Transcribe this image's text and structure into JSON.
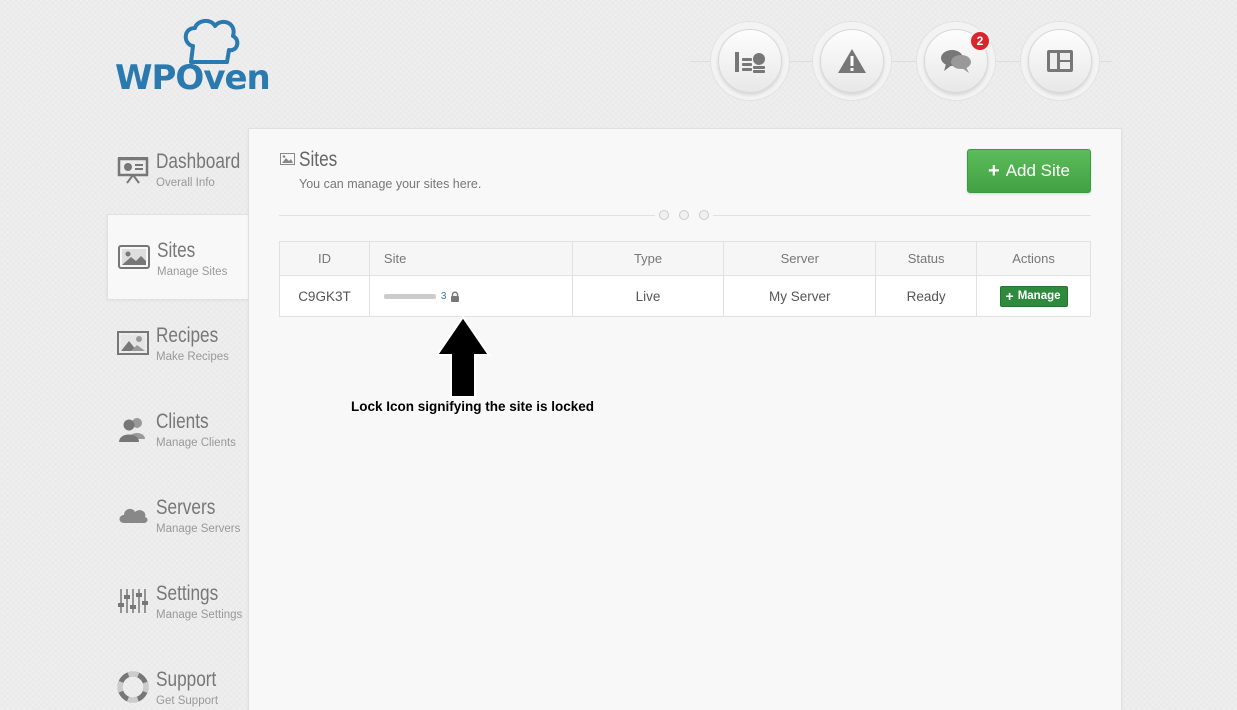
{
  "brand": {
    "name": "WPOven"
  },
  "top_nav": {
    "items": [
      {
        "icon": "coins-icon"
      },
      {
        "icon": "warning-icon"
      },
      {
        "icon": "chat-icon",
        "badge": "2"
      },
      {
        "icon": "layout-icon"
      }
    ]
  },
  "sidebar": {
    "items": [
      {
        "title": "Dashboard",
        "subtitle": "Overall Info",
        "icon": "presentation-icon"
      },
      {
        "title": "Sites",
        "subtitle": "Manage Sites",
        "icon": "image-icon",
        "active": true
      },
      {
        "title": "Recipes",
        "subtitle": "Make Recipes",
        "icon": "picture-frame-icon"
      },
      {
        "title": "Clients",
        "subtitle": "Manage Clients",
        "icon": "users-icon"
      },
      {
        "title": "Servers",
        "subtitle": "Manage Servers",
        "icon": "cloud-icon"
      },
      {
        "title": "Settings",
        "subtitle": "Manage Settings",
        "icon": "sliders-icon"
      },
      {
        "title": "Support",
        "subtitle": "Get Support",
        "icon": "lifebuoy-icon"
      }
    ]
  },
  "main": {
    "title": "Sites",
    "subtitle": "You can manage your sites here.",
    "add_button": "Add Site",
    "table": {
      "headers": [
        "ID",
        "Site",
        "Type",
        "Server",
        "Status",
        "Actions"
      ],
      "rows": [
        {
          "id": "C9GK3T",
          "site_num": "3",
          "type": "Live",
          "server": "My Server",
          "status": "Ready",
          "action": "Manage"
        }
      ]
    }
  },
  "annotation": {
    "text": "Lock Icon signifying the site is locked"
  },
  "colors": {
    "accent_green": "#42a142",
    "brand_blue": "#2a7ab0",
    "badge_red": "#d9262e"
  }
}
